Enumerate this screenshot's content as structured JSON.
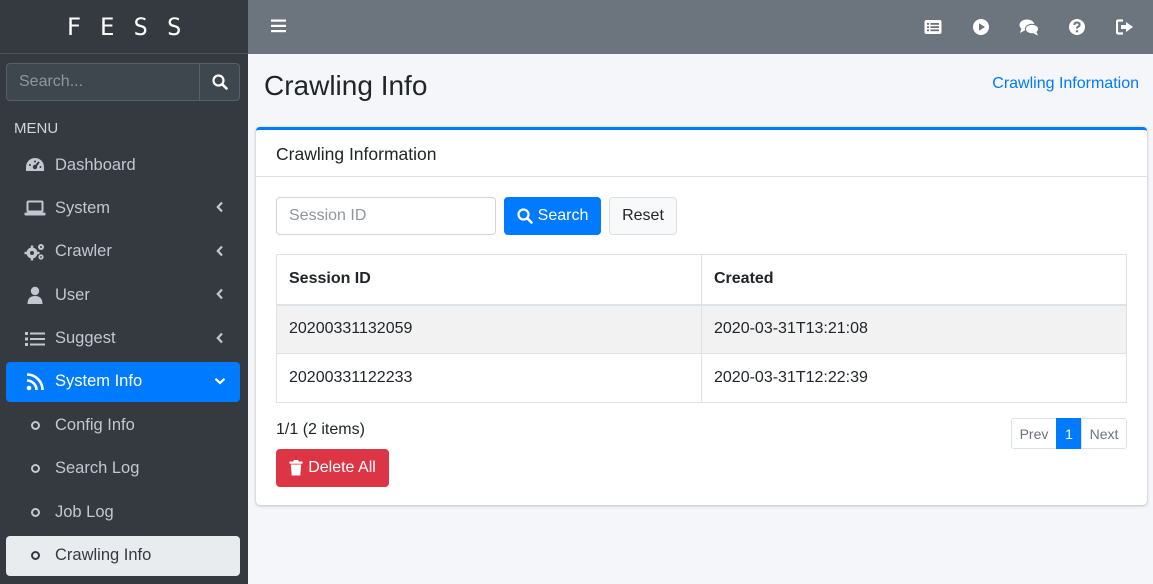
{
  "brand": "FESS",
  "sidebar": {
    "search_placeholder": "Search...",
    "menu_header": "MENU",
    "items": [
      {
        "label": "Dashboard",
        "icon": "dashboard-icon"
      },
      {
        "label": "System",
        "icon": "laptop-icon"
      },
      {
        "label": "Crawler",
        "icon": "cogs-icon"
      },
      {
        "label": "User",
        "icon": "user-icon"
      },
      {
        "label": "Suggest",
        "icon": "list-icon"
      },
      {
        "label": "System Info",
        "icon": "rss-icon"
      },
      {
        "label": "Config Info",
        "icon": "circle-icon"
      },
      {
        "label": "Search Log",
        "icon": "circle-icon"
      },
      {
        "label": "Job Log",
        "icon": "circle-icon"
      },
      {
        "label": "Crawling Info",
        "icon": "circle-icon"
      }
    ]
  },
  "topbar": {
    "icons": [
      "list-alt-icon",
      "play-circle-icon",
      "comments-icon",
      "question-circle-icon",
      "sign-out-icon"
    ]
  },
  "page": {
    "title": "Crawling Info",
    "breadcrumb": "Crawling Information"
  },
  "card": {
    "title": "Crawling Information",
    "session_placeholder": "Session ID",
    "search_label": "Search",
    "reset_label": "Reset",
    "table": {
      "headers": [
        "Session ID",
        "Created"
      ],
      "rows": [
        [
          "20200331132059",
          "2020-03-31T13:21:08"
        ],
        [
          "20200331122233",
          "2020-03-31T12:22:39"
        ]
      ]
    },
    "pager_info": "1/1 (2 items)",
    "pagination": {
      "prev": "Prev",
      "current": "1",
      "next": "Next"
    },
    "delete_all_label": "Delete All"
  },
  "colors": {
    "primary": "#007bff",
    "danger": "#dc3545",
    "sidebar": "#343a40",
    "topbar": "#6c757d"
  }
}
